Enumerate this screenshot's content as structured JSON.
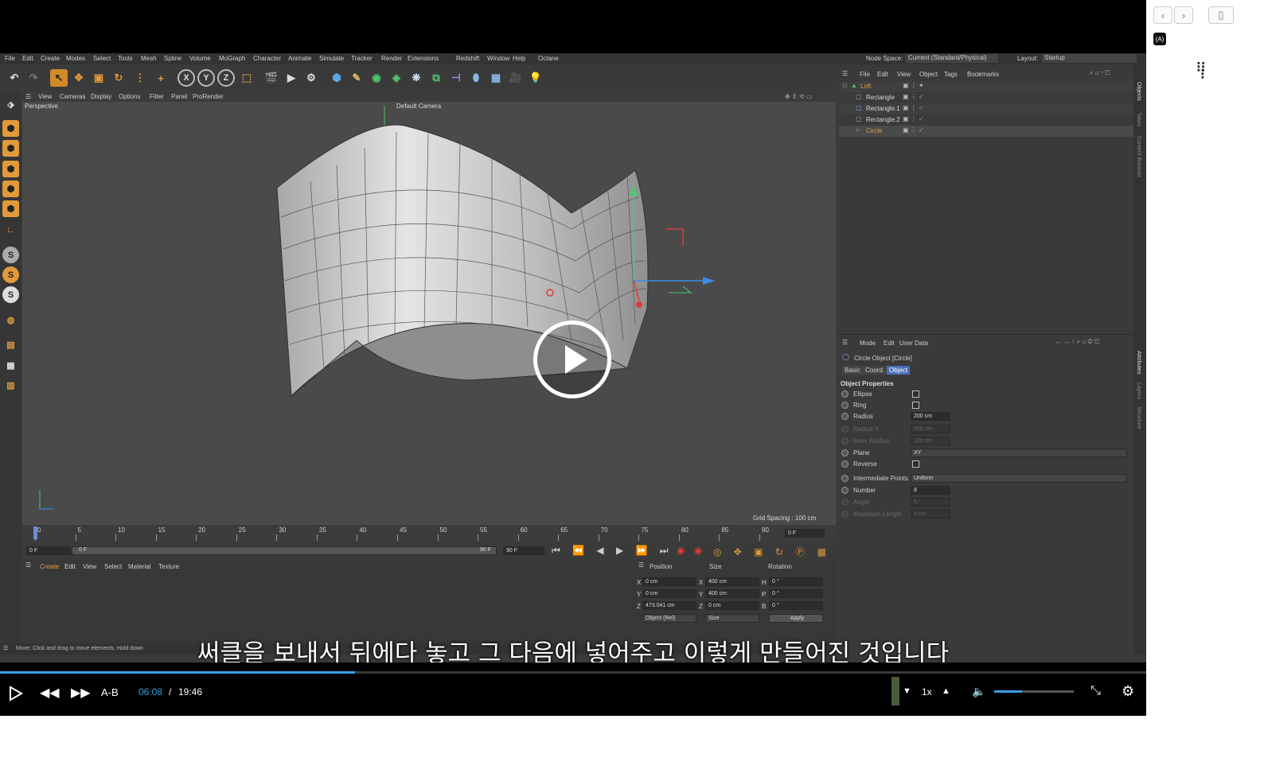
{
  "app": {
    "menu": [
      "File",
      "Edit",
      "Create",
      "Modes",
      "Select",
      "Tools",
      "Mesh",
      "Spline",
      "Volume",
      "MoGraph",
      "Character",
      "Animate",
      "Simulate",
      "Tracker",
      "Render",
      "Extensions",
      "Redshift",
      "Window",
      "Help",
      "Octane"
    ],
    "node_space_label": "Node Space:",
    "node_space_value": "Current (Standard/Physical)",
    "layout_label": "Layout:",
    "layout_value": "Startup"
  },
  "viewport": {
    "menu": [
      "View",
      "Cameras",
      "Display",
      "Options",
      "Filter",
      "Panel",
      "ProRender"
    ],
    "view_name": "Perspective",
    "camera": "Default Camera",
    "grid_spacing": "Grid Spacing : 100 cm"
  },
  "timeline": {
    "ticks": [
      "0",
      "5",
      "10",
      "15",
      "20",
      "25",
      "30",
      "35",
      "40",
      "45",
      "50",
      "55",
      "60",
      "65",
      "70",
      "75",
      "80",
      "85",
      "90"
    ],
    "current_frame": "0 F",
    "start": "0 F",
    "range_start": "0 F",
    "range_end": "90 F",
    "end": "90 F"
  },
  "material_panel": {
    "menu": [
      "Create",
      "Edit",
      "View",
      "Select",
      "Material",
      "Texture"
    ]
  },
  "coords": {
    "headers": [
      "Position",
      "Size",
      "Rotation"
    ],
    "rows": [
      {
        "axis": "X",
        "pos": "0 cm",
        "size_axis": "X",
        "size": "400 cm",
        "rot_axis": "H",
        "rot": "0 °"
      },
      {
        "axis": "Y",
        "pos": "0 cm",
        "size_axis": "Y",
        "size": "400 cm",
        "rot_axis": "P",
        "rot": "0 °"
      },
      {
        "axis": "Z",
        "pos": "473.041 cm",
        "size_axis": "Z",
        "size": "0 cm",
        "rot_axis": "B",
        "rot": "0 °"
      }
    ],
    "mode": "Object (Rel)",
    "size_mode": "Size",
    "apply": "Apply"
  },
  "status": "Move: Click and drag to move elements. Hold down",
  "objects": {
    "menu": [
      "File",
      "Edit",
      "View",
      "Object",
      "Tags",
      "Bookmarks"
    ],
    "items": [
      "Loft",
      "Rectangle",
      "Rectangle.1",
      "Rectangle.2",
      "Circle"
    ]
  },
  "attributes": {
    "menu": [
      "Mode",
      "Edit",
      "User Data"
    ],
    "object_title": "Circle Object [Circle]",
    "tabs": [
      "Basic",
      "Coord.",
      "Object"
    ],
    "section": "Object Properties",
    "props": [
      {
        "label": "Ellipse",
        "value": ""
      },
      {
        "label": "Ring",
        "value": ""
      },
      {
        "label": "Radius",
        "value": "200 cm"
      },
      {
        "label": "Radius Y",
        "value": "200 cm"
      },
      {
        "label": "Inner Radius",
        "value": "100 cm"
      },
      {
        "label": "Plane",
        "value": "XY"
      },
      {
        "label": "Reverse",
        "value": ""
      },
      {
        "label": "Intermediate Points",
        "value": "Uniform"
      },
      {
        "label": "Number",
        "value": "8"
      },
      {
        "label": "Angle",
        "value": "5 °"
      },
      {
        "label": "Maximum Length",
        "value": "5 cm"
      }
    ]
  },
  "side_tabs": [
    "Objects",
    "Takes",
    "Content Browser",
    "Attributes",
    "Layers",
    "Structure"
  ],
  "subtitle": "써클을 보내서 뒤에다 놓고 그 다음에 넣어주고 이렇게 만들어진 것입니다",
  "player": {
    "ab_label": "A-B",
    "current_time": "06:08",
    "separator": "/",
    "duration": "19:46",
    "speed": "1x",
    "progress": 0.31,
    "volume": 0.35
  }
}
